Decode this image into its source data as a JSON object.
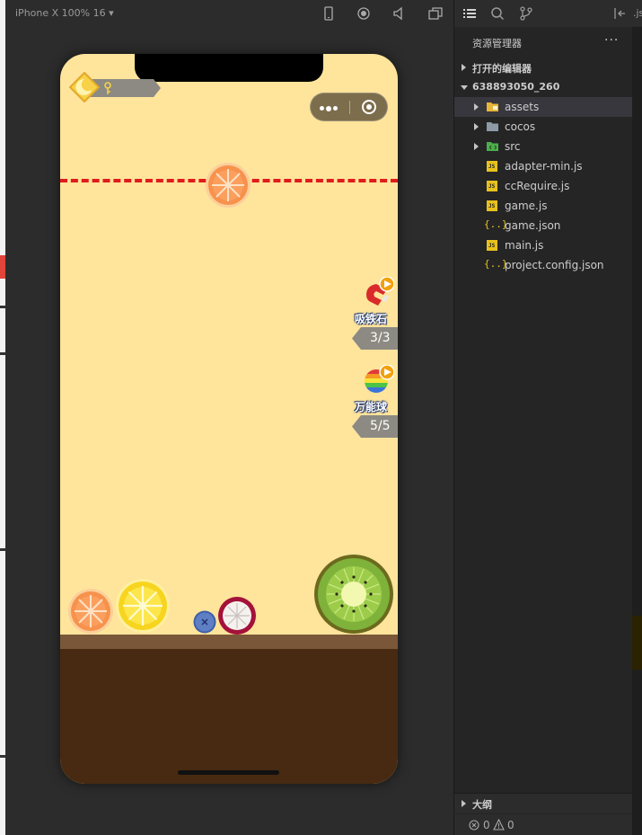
{
  "toolbar": {
    "device_label": "iPhone X 100% 16 ▾"
  },
  "game": {
    "powerups": [
      {
        "name": "吸铁石",
        "count": "3/3",
        "icon": "magnet-icon"
      },
      {
        "name": "万能球",
        "count": "5/5",
        "icon": "rainbow-ball-icon"
      }
    ],
    "fruits": [
      "orange",
      "orange",
      "lemon",
      "blueberry",
      "mangosteen",
      "kiwi"
    ]
  },
  "explorer": {
    "title": "资源管理器",
    "more": "···",
    "open_editors": "打开的编辑器",
    "project": "638893050_260",
    "files": [
      {
        "name": "assets",
        "type": "folder"
      },
      {
        "name": "cocos",
        "type": "folder"
      },
      {
        "name": "src",
        "type": "folder"
      },
      {
        "name": "adapter-min.js",
        "type": "js"
      },
      {
        "name": "ccRequire.js",
        "type": "js"
      },
      {
        "name": "game.js",
        "type": "js"
      },
      {
        "name": "game.json",
        "type": "json"
      },
      {
        "name": "main.js",
        "type": "js"
      },
      {
        "name": "project.config.json",
        "type": "json"
      }
    ],
    "outline": "大纲",
    "errors": "0",
    "warnings": "0",
    "tab_fragment": ".js"
  }
}
